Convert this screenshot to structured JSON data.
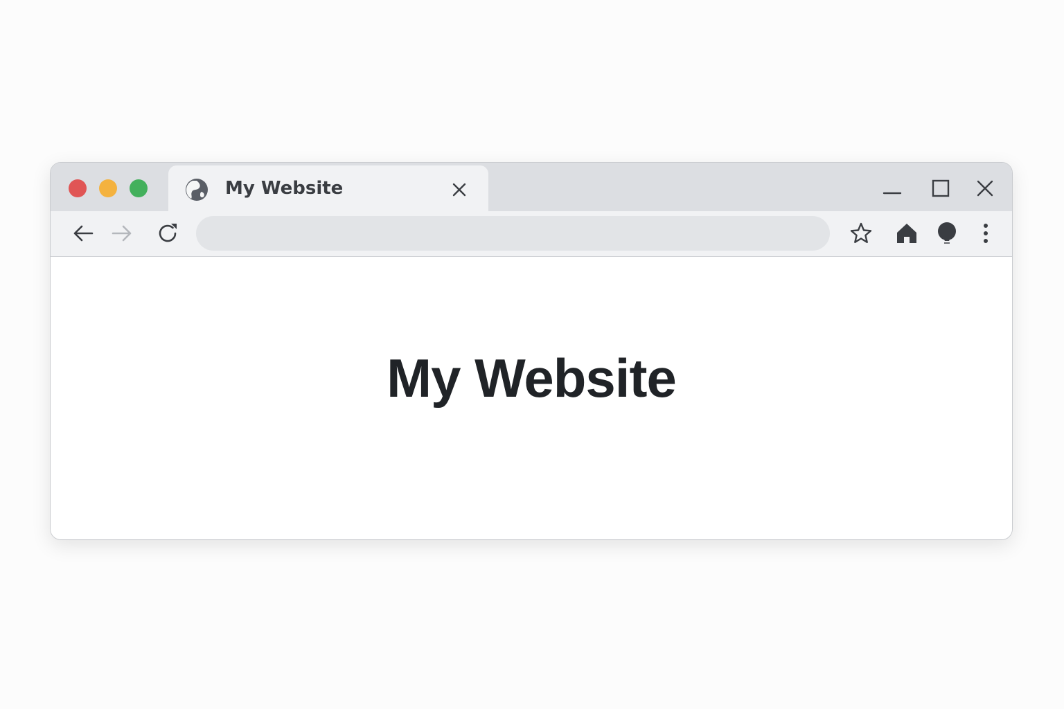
{
  "window": {
    "traffic_lights": [
      {
        "name": "close",
        "color": "#e05555"
      },
      {
        "name": "minimize",
        "color": "#f4b23f"
      },
      {
        "name": "maximize",
        "color": "#43b05c"
      }
    ],
    "controls": [
      "minimize-icon",
      "maximize-icon",
      "close-icon"
    ]
  },
  "tab": {
    "title": "My Website",
    "icon": "globe-icon",
    "close_icon": "close-icon"
  },
  "toolbar": {
    "back_icon": "arrow-left-icon",
    "forward_icon": "arrow-right-icon",
    "reload_icon": "reload-icon",
    "address_value": "",
    "address_placeholder": "",
    "right_icons": [
      "star-icon",
      "home-icon",
      "lightbulb-icon",
      "more-vertical-icon"
    ]
  },
  "page": {
    "heading": "My Website"
  },
  "colors": {
    "titlebar": "#dcdee2",
    "toolbar": "#f1f2f4",
    "address_bar": "#e2e4e7",
    "icon": "#52565c",
    "heading_text": "#202327"
  }
}
